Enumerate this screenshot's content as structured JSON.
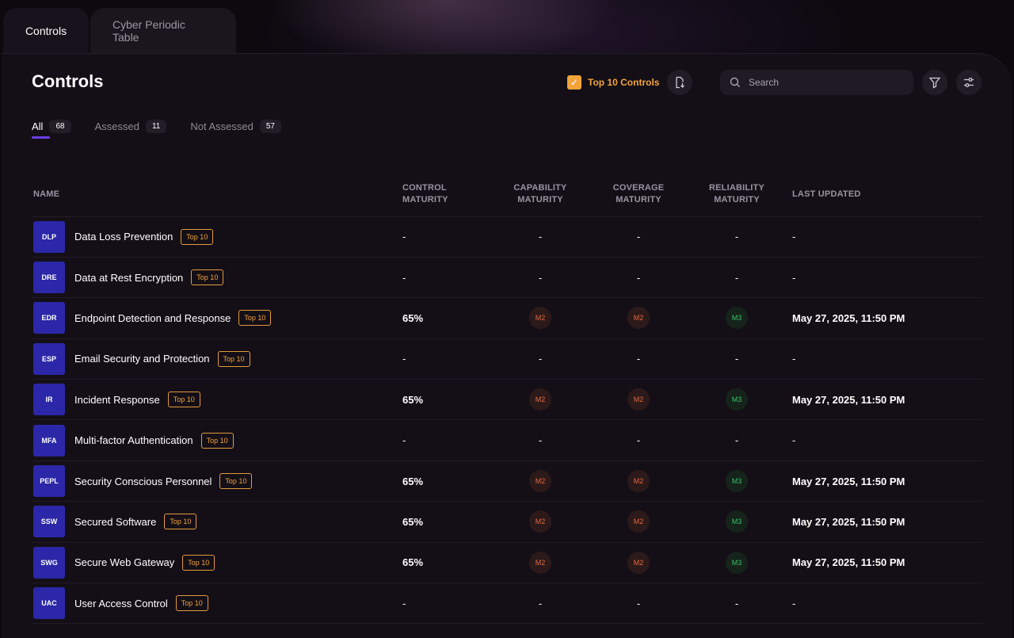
{
  "top_tabs": [
    {
      "label": "Controls"
    },
    {
      "label": "Cyber Periodic Table"
    }
  ],
  "header": {
    "title": "Controls",
    "top10_toggle": {
      "label": "Top 10 Controls",
      "checked": true
    },
    "search": {
      "placeholder": "Search"
    }
  },
  "filters": [
    {
      "label": "All",
      "count": "68"
    },
    {
      "label": "Assessed",
      "count": "11"
    },
    {
      "label": "Not Assessed",
      "count": "57"
    }
  ],
  "table": {
    "headers": {
      "name": "NAME",
      "control_maturity": "CONTROL MATURITY",
      "capability_maturity": "CAPABILITY MATURITY",
      "coverage_maturity": "COVERAGE MATURITY",
      "reliability_maturity": "RELIABILITY MATURITY",
      "last_updated": "LAST UPDATED"
    },
    "rows": [
      {
        "abbr": "DLP",
        "name": "Data Loss Prevention",
        "badge": "Top 10",
        "control": "-",
        "capability": "-",
        "coverage": "-",
        "reliability": "-",
        "updated": "-"
      },
      {
        "abbr": "DRE",
        "name": "Data at Rest Encryption",
        "badge": "Top 10",
        "control": "-",
        "capability": "-",
        "coverage": "-",
        "reliability": "-",
        "updated": "-"
      },
      {
        "abbr": "EDR",
        "name": "Endpoint Detection and Response",
        "badge": "Top 10",
        "control": "65%",
        "capability": "M2",
        "coverage": "M2",
        "reliability": "M3",
        "updated": "May 27, 2025, 11:50 PM"
      },
      {
        "abbr": "ESP",
        "name": "Email Security and Protection",
        "badge": "Top 10",
        "control": "-",
        "capability": "-",
        "coverage": "-",
        "reliability": "-",
        "updated": "-"
      },
      {
        "abbr": "IR",
        "name": "Incident Response",
        "badge": "Top 10",
        "control": "65%",
        "capability": "M2",
        "coverage": "M2",
        "reliability": "M3",
        "updated": "May 27, 2025, 11:50 PM"
      },
      {
        "abbr": "MFA",
        "name": "Multi-factor Authentication",
        "badge": "Top 10",
        "control": "-",
        "capability": "-",
        "coverage": "-",
        "reliability": "-",
        "updated": "-"
      },
      {
        "abbr": "PEPL",
        "name": "Security Conscious Personnel",
        "badge": "Top 10",
        "control": "65%",
        "capability": "M2",
        "coverage": "M2",
        "reliability": "M3",
        "updated": "May 27, 2025, 11:50 PM"
      },
      {
        "abbr": "SSW",
        "name": "Secured Software",
        "badge": "Top 10",
        "control": "65%",
        "capability": "M2",
        "coverage": "M2",
        "reliability": "M3",
        "updated": "May 27, 2025, 11:50 PM"
      },
      {
        "abbr": "SWG",
        "name": "Secure Web Gateway",
        "badge": "Top 10",
        "control": "65%",
        "capability": "M2",
        "coverage": "M2",
        "reliability": "M3",
        "updated": "May 27, 2025, 11:50 PM"
      },
      {
        "abbr": "UAC",
        "name": "User Access Control",
        "badge": "Top 10",
        "control": "-",
        "capability": "-",
        "coverage": "-",
        "reliability": "-",
        "updated": "-"
      }
    ]
  },
  "colors": {
    "accent_orange": "#f2a33a",
    "tab_underline": "#6a3de8",
    "abbr_bg": "#2b27a8",
    "m2": "#e06a44",
    "m3": "#3fbf6a"
  }
}
